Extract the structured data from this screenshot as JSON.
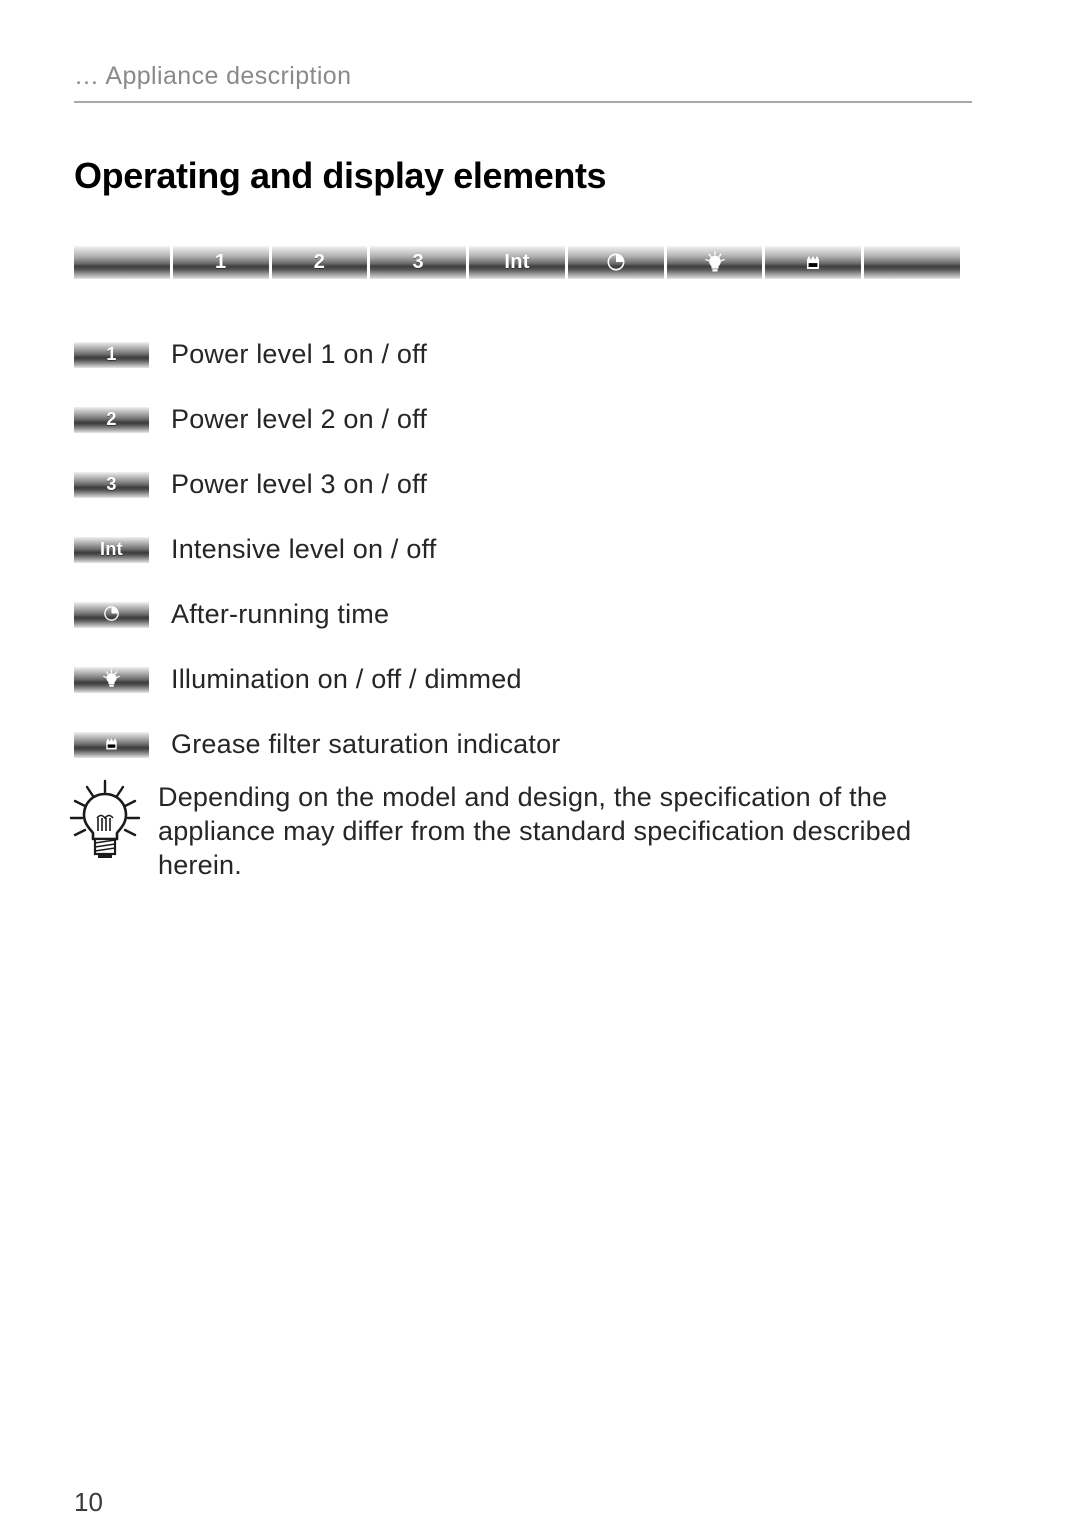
{
  "header": {
    "running_head": "… Appliance description",
    "title": "Operating and display elements"
  },
  "control_panel": {
    "name": "cooker-hood-control-panel",
    "segments": [
      {
        "type": "blank",
        "label": ""
      },
      {
        "type": "text",
        "label": "1",
        "icon": ""
      },
      {
        "type": "text",
        "label": "2",
        "icon": ""
      },
      {
        "type": "text",
        "label": "3",
        "icon": ""
      },
      {
        "type": "text",
        "label": "Int",
        "icon": ""
      },
      {
        "type": "icon",
        "label": "",
        "icon": "after-running-timer-icon"
      },
      {
        "type": "icon",
        "label": "",
        "icon": "light-bulb-icon"
      },
      {
        "type": "icon",
        "label": "",
        "icon": "grease-filter-icon"
      },
      {
        "type": "blank",
        "label": ""
      }
    ]
  },
  "legend": {
    "items": [
      {
        "key": "power-level-1",
        "button_label": "1",
        "icon": "",
        "description": "Power level 1 on / off"
      },
      {
        "key": "power-level-2",
        "button_label": "2",
        "icon": "",
        "description": "Power level 2 on / off"
      },
      {
        "key": "power-level-3",
        "button_label": "3",
        "icon": "",
        "description": "Power level 3 on / off"
      },
      {
        "key": "intensive-level",
        "button_label": "Int",
        "icon": "",
        "description": "Intensive level on / off"
      },
      {
        "key": "after-running",
        "button_label": "",
        "icon": "after-running-timer-icon",
        "description": "After-running time"
      },
      {
        "key": "illumination",
        "button_label": "",
        "icon": "light-bulb-icon",
        "description": "Illumination on / off / dimmed"
      },
      {
        "key": "grease-filter",
        "button_label": "",
        "icon": "grease-filter-icon",
        "description": "Grease filter saturation indicator"
      }
    ]
  },
  "note": {
    "icon": "tip-bulb-icon",
    "text": "Depending on the model and design, the specification of the appliance may differ from the standard specification described herein."
  },
  "footer": {
    "page_number": "10"
  },
  "colors": {
    "rule": "#a8a8a8",
    "running_head": "#8a8a8a",
    "body_text": "#262626",
    "title": "#000000"
  }
}
